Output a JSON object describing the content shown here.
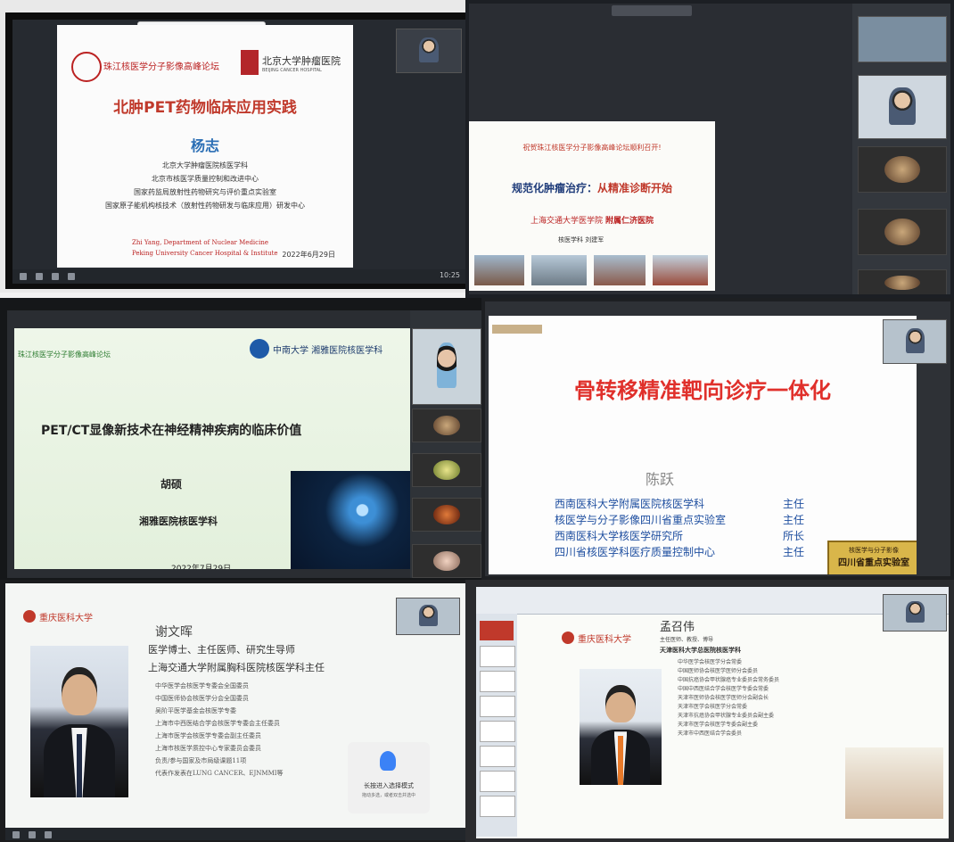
{
  "panel1": {
    "header_left": "珠江核医学分子影像高峰论坛",
    "header_right_logo": "北京大学肿瘤医院",
    "header_right_sub": "BEIJING CANCER HOSPITAL",
    "title": "北肿PET药物临床应用实践",
    "speaker": "杨志",
    "affiliations": [
      "北京大学肿瘤医院核医学科",
      "北京市核医学质量控制和改进中心",
      "国家药监局放射性药物研究与评价重点实验室",
      "国家原子能机构核技术（放射性药物研发与临床应用）研发中心"
    ],
    "en_line1": "Zhi Yang, Department of Nuclear Medicine",
    "en_line2": "Peking University Cancer Hospital & Institute",
    "date": "2022年6月29日"
  },
  "panel2": {
    "congrats": "祝贺珠江核医学分子影像高峰论坛顺利召开!",
    "title_a": "规范化肿瘤治疗：",
    "title_b": "从精准诊断开始",
    "institution_a": "上海交通大学医学院",
    "institution_b": "附属仁济医院",
    "speaker_line": "核医学科  刘建军"
  },
  "panel3": {
    "forum": "珠江核医学分子影像高峰论坛",
    "logo_text": "中南大学  湘雅医院核医学科",
    "title": "PET/CT显像新技术在神经精神疾病的临床价值",
    "speaker": "胡硕",
    "dept": "湘雅医院核医学科",
    "date": "2022年7月29日"
  },
  "panel4": {
    "title": "骨转移精准靶向诊疗一体化",
    "speaker": "陈跃",
    "roles": [
      {
        "org": "西南医科大学附属医院核医学科",
        "role": "主任"
      },
      {
        "org": "核医学与分子影像四川省重点实验室",
        "role": "主任"
      },
      {
        "org": "西南医科大学核医学研究所",
        "role": "所长"
      },
      {
        "org": "四川省核医学科医疗质量控制中心",
        "role": "主任"
      }
    ],
    "plaque_a": "核医学与分子影像",
    "plaque_b": "四川省重点实验室"
  },
  "panel5": {
    "logo": "重庆医科大学",
    "name": "谢文晖",
    "title1": "医学博士、主任医师、研究生导师",
    "title2": "上海交通大学附属胸科医院核医学科主任",
    "posts": [
      "中华医学会核医学专委会全国委员",
      "中国医师协会核医学分会全国委员",
      "吴阶平医学基金会核医学专委",
      "上海市中西医结合学会核医学专委会主任委员",
      "上海市医学会核医学专委会副主任委员",
      "上海市核医学质控中心专家委员会委员",
      "负责/参与国家及市局级课题11项",
      "代表作发表在LUNG CANCER、EJNMMI等"
    ],
    "hint1": "长按进入选择模式",
    "hint2": "拖动多选，或者双击并选中"
  },
  "panel6": {
    "logo": "重庆医科大学",
    "name": "孟召伟",
    "title1": "主任医师、教授、博导",
    "title2": "天津医科大学总医院核医学科",
    "posts": [
      "中华医学会核医学分会常委",
      "中国医师协会核医学医师分会委员",
      "中国抗癌协会甲状腺癌专业委员会常务委员",
      "中国中西医结合学会核医学专委会常委",
      "天津市医师协会核医学医师分会副会长",
      "天津市医学会核医学分会常委",
      "天津市抗癌协会甲状腺专业委员会副主委",
      "天津市医学会核医学专委会副主委",
      "天津市中西医结合学会委员"
    ]
  },
  "taskbar_clock": "10:25"
}
